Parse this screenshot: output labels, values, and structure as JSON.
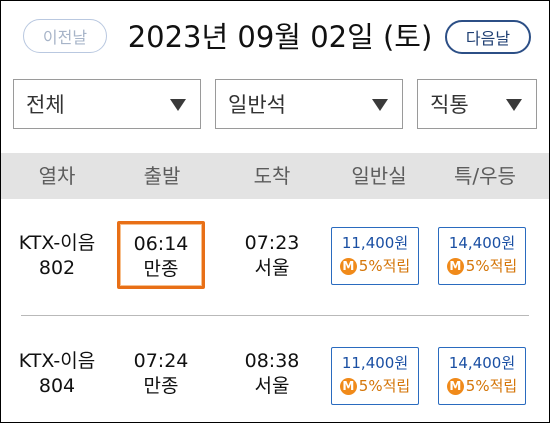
{
  "date_nav": {
    "prev_label": "이전날",
    "title": "2023년 09월 02일 (토)",
    "next_label": "다음날"
  },
  "filters": {
    "train_type": "전체",
    "seat_class": "일반석",
    "route_type": "직통"
  },
  "table": {
    "headers": [
      "열차",
      "출발",
      "도착",
      "일반실",
      "특/우등"
    ],
    "rows": [
      {
        "train_name": "KTX-이음",
        "train_no": "802",
        "dep_time": "06:14",
        "dep_station": "만종",
        "arr_time": "07:23",
        "arr_station": "서울",
        "general_price": "11,400원",
        "general_point": "5%적립",
        "special_price": "14,400원",
        "special_point": "5%적립",
        "selected": true
      },
      {
        "train_name": "KTX-이음",
        "train_no": "804",
        "dep_time": "07:24",
        "dep_station": "만종",
        "arr_time": "08:38",
        "arr_station": "서울",
        "general_price": "11,400원",
        "general_point": "5%적립",
        "special_price": "14,400원",
        "special_point": "5%적립",
        "selected": false
      }
    ]
  },
  "mileage_icon": {
    "icon": "m-mileage-icon",
    "letter": "M",
    "color": "#f08a1a"
  },
  "colors": {
    "accent": "#1f3f73",
    "selected_border": "#e86f16",
    "price_border": "#2a6bbf"
  }
}
